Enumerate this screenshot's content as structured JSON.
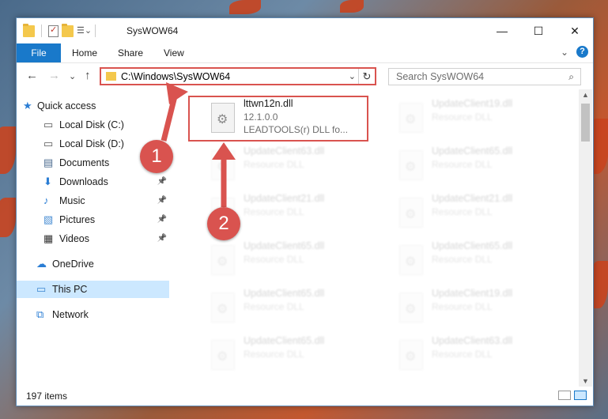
{
  "window": {
    "title": "SysWOW64",
    "minimize": "—",
    "maximize": "☐",
    "close": "✕"
  },
  "ribbon": {
    "file": "File",
    "home": "Home",
    "share": "Share",
    "view": "View",
    "expand": "⌄",
    "help": "?"
  },
  "nav": {
    "back": "←",
    "forward": "→",
    "recent": "⌄",
    "up": "↑",
    "address": "C:\\Windows\\SysWOW64",
    "address_dropdown": "⌄",
    "refresh": "↻",
    "search_placeholder": "Search SysWOW64",
    "search_icon": "⌕"
  },
  "sidebar": {
    "items": [
      {
        "label": "Quick access",
        "icon": "star-icon",
        "pinned": false
      },
      {
        "label": "Local Disk (C:)",
        "icon": "drive-icon",
        "pinned": false
      },
      {
        "label": "Local Disk (D:)",
        "icon": "drive-icon",
        "pinned": false
      },
      {
        "label": "Documents",
        "icon": "documents-icon",
        "pinned": false
      },
      {
        "label": "Downloads",
        "icon": "download-icon",
        "pinned": true
      },
      {
        "label": "Music",
        "icon": "music-icon",
        "pinned": true
      },
      {
        "label": "Pictures",
        "icon": "pictures-icon",
        "pinned": true
      },
      {
        "label": "Videos",
        "icon": "videos-icon",
        "pinned": true
      },
      {
        "label": "OneDrive",
        "icon": "cloud-icon",
        "pinned": false
      },
      {
        "label": "This PC",
        "icon": "computer-icon",
        "pinned": false,
        "selected": true
      },
      {
        "label": "Network",
        "icon": "network-icon",
        "pinned": false
      }
    ],
    "pin_glyph": "📌"
  },
  "files": {
    "highlighted": {
      "name": "lttwn12n.dll",
      "version": "12.1.0.0",
      "description": "LEADTOOLS(r) DLL fo..."
    },
    "left_column": [
      {
        "name": "UpdateClient63.dll",
        "type": "Resource DLL"
      },
      {
        "name": "UpdateClient21.dll",
        "type": "Resource DLL"
      },
      {
        "name": "UpdateClient65.dll",
        "type": "Resource DLL"
      },
      {
        "name": "UpdateClient65.dll",
        "type": "Resource DLL"
      },
      {
        "name": "UpdateClient65.dll",
        "type": "Resource DLL"
      }
    ],
    "right_column": [
      {
        "name": "UpdateClient19.dll",
        "type": "Resource DLL"
      },
      {
        "name": "UpdateClient65.dll",
        "type": "Resource DLL"
      },
      {
        "name": "UpdateClient21.dll",
        "type": "Resource DLL"
      },
      {
        "name": "UpdateClient65.dll",
        "type": "Resource DLL"
      },
      {
        "name": "UpdateClient19.dll",
        "type": "Resource DLL"
      },
      {
        "name": "UpdateClient63.dll",
        "type": "Resource DLL"
      }
    ]
  },
  "status": {
    "item_count": "197 items"
  },
  "callouts": {
    "one": "1",
    "two": "2"
  },
  "colors": {
    "accent": "#1979ca",
    "highlight": "#d9534f",
    "selection": "#cce8ff"
  }
}
